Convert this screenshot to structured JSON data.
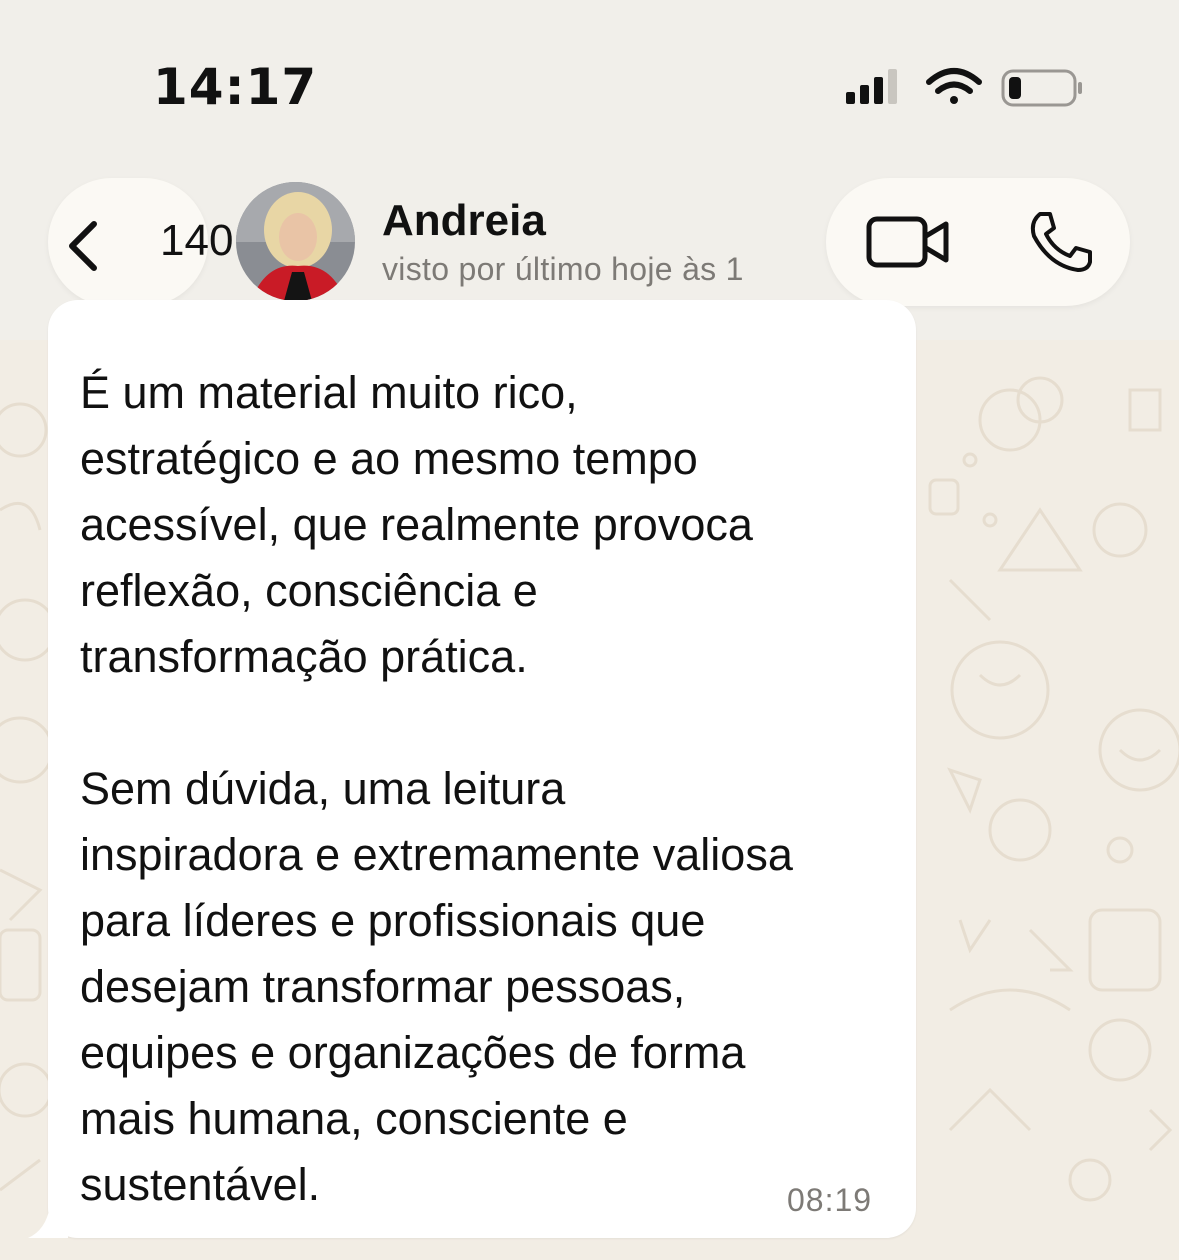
{
  "status_bar": {
    "time": "14:17",
    "signal_icon": "cellular-signal-icon",
    "wifi_icon": "wifi-icon",
    "battery_icon": "battery-low-icon"
  },
  "header": {
    "back_icon": "chevron-left-icon",
    "unread_count": "140",
    "contact_name": "Andreia",
    "contact_status": "visto por último hoje às 1",
    "video_icon": "video-camera-icon",
    "call_icon": "phone-icon"
  },
  "message": {
    "text": "É um material muito rico,\nestratégico e ao mesmo tempo\nacessível, que realmente provoca\nreflexão, consciência e\ntransformação prática.\n\nSem dúvida, uma leitura\ninspiradora e extremamente valiosa\npara líderes e profissionais que\ndesejam transformar pessoas,\nequipes e organizações de forma\nmais humana, consciente e\nsustentável.",
    "time": "08:19"
  },
  "colors": {
    "background": "#f1efea",
    "wallpaper": "#f2ede4",
    "bubble": "#ffffff",
    "muted_text": "#7d7a76"
  }
}
